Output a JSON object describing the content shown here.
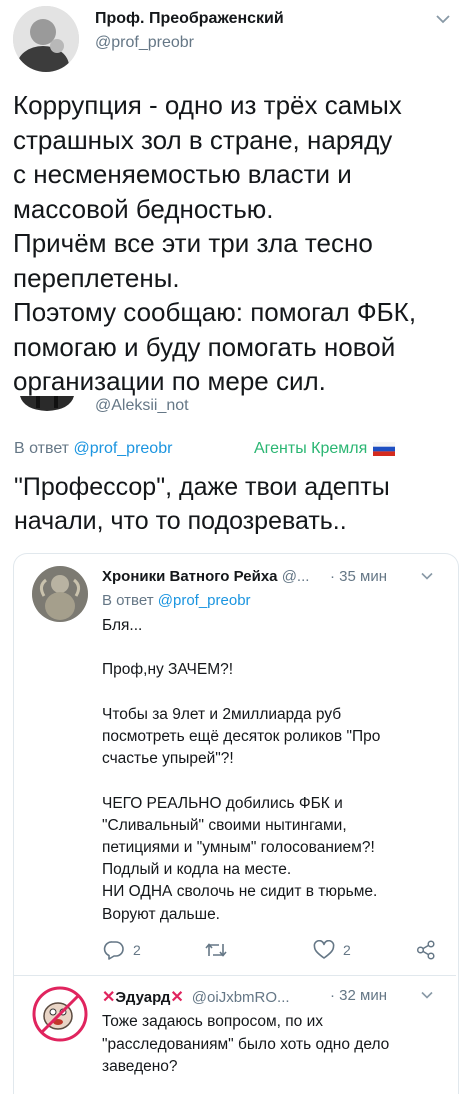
{
  "tweet1": {
    "display_name": "Проф. Преображенский",
    "handle": "@prof_preobr",
    "lines": [
      "Коррупция - одно из трёх самых",
      "страшных зол в стране, наряду",
      "с несменяемостью власти и",
      "массовой бедностью.",
      "Причём все эти три зла тесно",
      "переплетены.",
      "Поэтому сообщаю: помогал ФБК,",
      "помогаю и буду помогать новой",
      "организации по мере сил."
    ]
  },
  "tweet2": {
    "handle": "@Aleksii_not",
    "reply_prefix": "В ответ",
    "reply_to": "@prof_preobr",
    "label": "Агенты Кремля",
    "lines": [
      "\"Профессор\", даже твои адепты",
      "начали, что то подозревать.."
    ]
  },
  "quoted": {
    "display_name": "Хроники Ватного Рейха",
    "handle": "@...",
    "time": "· 35 мин",
    "reply_prefix": "В ответ",
    "reply_to": "@prof_preobr",
    "lines": [
      "Бля...",
      "",
      "Проф,ну ЗАЧЕМ?!",
      "",
      "Чтобы за 9лет и 2миллиарда руб",
      "посмотреть ещё десяток роликов \"Про",
      "счастье упырей\"?!",
      "",
      "ЧЕГО РЕАЛЬНО добились ФБК и",
      "\"Сливальный\" своими нытингами,",
      "петициями и \"умным\" голосованием?!",
      "Подлый и кодла на месте.",
      "НИ ОДНА сволочь не сидит в тюрьме.",
      "Воруют дальше."
    ],
    "reply_count": "2",
    "like_count": "2"
  },
  "reply": {
    "display_name": "Эдуард",
    "handle": "@oiJxbmRO...",
    "time": "· 32 мин",
    "lines": [
      "Тоже задаюсь вопросом, по их",
      "\"расследованиям\" было хоть одно дело",
      "заведено?"
    ]
  },
  "colors": {
    "text": "#14171a",
    "muted": "#657786",
    "link": "#1b95e0",
    "label_green": "#2bb673",
    "cross_red": "#e0245e"
  }
}
